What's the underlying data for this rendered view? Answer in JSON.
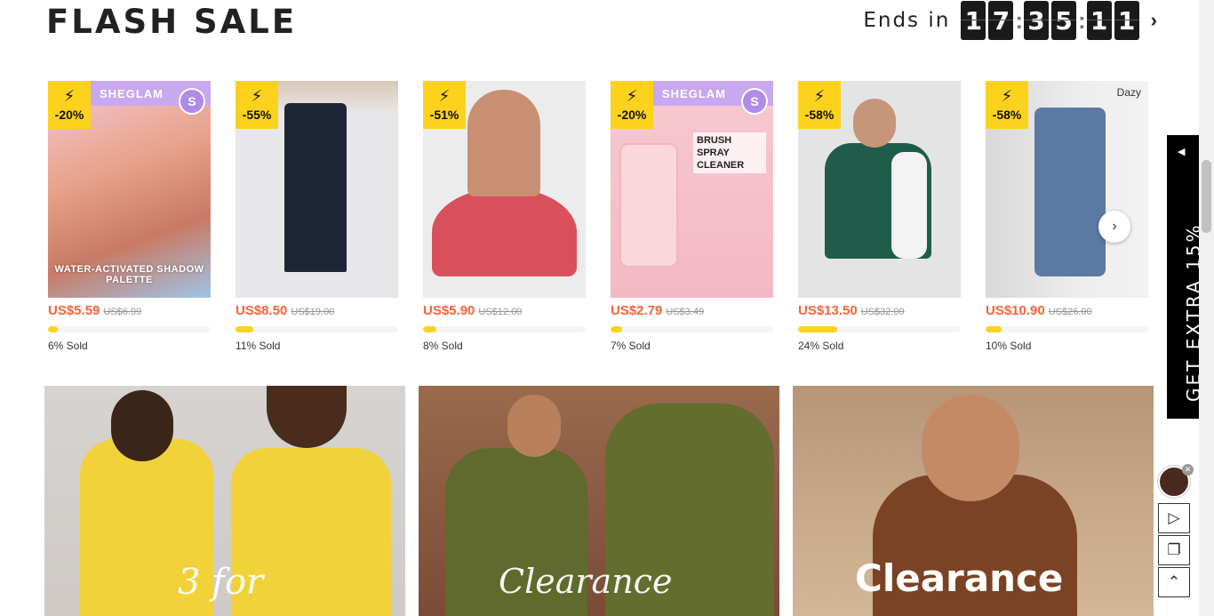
{
  "flash_sale": {
    "title": "FLASH SALE",
    "ends_label": "Ends in",
    "countdown": [
      "1",
      "7",
      "3",
      "5",
      "1",
      "1"
    ],
    "next_icon": "chevron-right-icon"
  },
  "products": [
    {
      "discount": "-20%",
      "brand": "SHEGLAM",
      "caption": "WATER-ACTIVATED SHADOW PALETTE",
      "price": "US$5.59",
      "old_price": "US$6.99",
      "sold_pct": 6,
      "sold_label": "6% Sold"
    },
    {
      "discount": "-55%",
      "price": "US$8.50",
      "old_price": "US$19.00",
      "sold_pct": 11,
      "sold_label": "11% Sold"
    },
    {
      "discount": "-51%",
      "price": "US$5.90",
      "old_price": "US$12.00",
      "sold_pct": 8,
      "sold_label": "8% Sold"
    },
    {
      "discount": "-20%",
      "brand": "SHEGLAM",
      "caption": "BRUSH SPRAY CLEANER",
      "price": "US$2.79",
      "old_price": "US$3.49",
      "sold_pct": 7,
      "sold_label": "7% Sold"
    },
    {
      "discount": "-58%",
      "price": "US$13.50",
      "old_price": "US$32.00",
      "sold_pct": 24,
      "sold_label": "24% Sold"
    },
    {
      "discount": "-58%",
      "tag": "Dazy",
      "price": "US$10.90",
      "old_price": "US$26.00",
      "sold_pct": 10,
      "sold_label": "10% Sold"
    }
  ],
  "banners": [
    {
      "text": "3 for"
    },
    {
      "text": "Clearance"
    },
    {
      "text": "Clearance"
    }
  ],
  "side_promo": {
    "text": "GET EXTRA 15%"
  },
  "colors": {
    "accent_price": "#fa6338",
    "badge": "#fcd21c",
    "brand_purple": "#c8a9f0"
  }
}
